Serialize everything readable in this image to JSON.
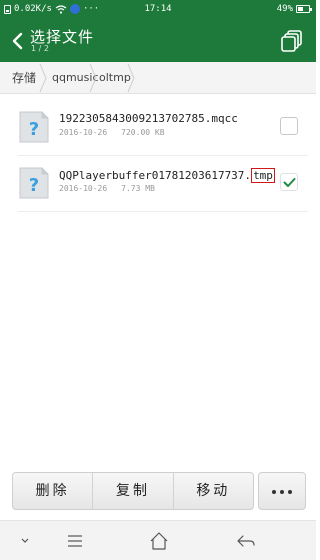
{
  "status_bar": {
    "network_speed": "0.02K/s",
    "extra": "···",
    "time": "17:14",
    "battery_percent": "49%",
    "battery_level": 0.49,
    "icons": [
      "phone-icon",
      "wifi-icon",
      "notification-icon",
      "battery-icon"
    ]
  },
  "header": {
    "title": "选择文件",
    "selection_count": "1 / 2",
    "back_icon": "back-arrow-icon",
    "multi_select_icon": "multi-window-icon",
    "background_color": "#1e7a3a"
  },
  "breadcrumb": {
    "items": [
      "存储",
      "qqmusic",
      "oltmp"
    ]
  },
  "files": [
    {
      "name": "192230584300921370278",
      "name_suffix": "5.mqcc",
      "date": "2016-10-26",
      "size": "720.00 KB",
      "checked": false,
      "icon": "unknown-file-icon"
    },
    {
      "name_prefix": "QQPlayerbuffer01781203617737.",
      "extension": "tmp",
      "date": "2016-10-26",
      "size": "7.73 MB",
      "checked": true,
      "icon": "unknown-file-icon"
    }
  ],
  "actions": {
    "delete_label": "删除",
    "copy_label": "复制",
    "move_label": "移动",
    "more_icon": "more-dots-icon"
  },
  "nav_bar": {
    "icons": [
      "chevron-down-icon",
      "menu-icon",
      "home-icon",
      "back-icon"
    ]
  },
  "colors": {
    "accent": "#1e7a3a",
    "check": "#1e8a46",
    "highlight_box": "#d01818"
  }
}
